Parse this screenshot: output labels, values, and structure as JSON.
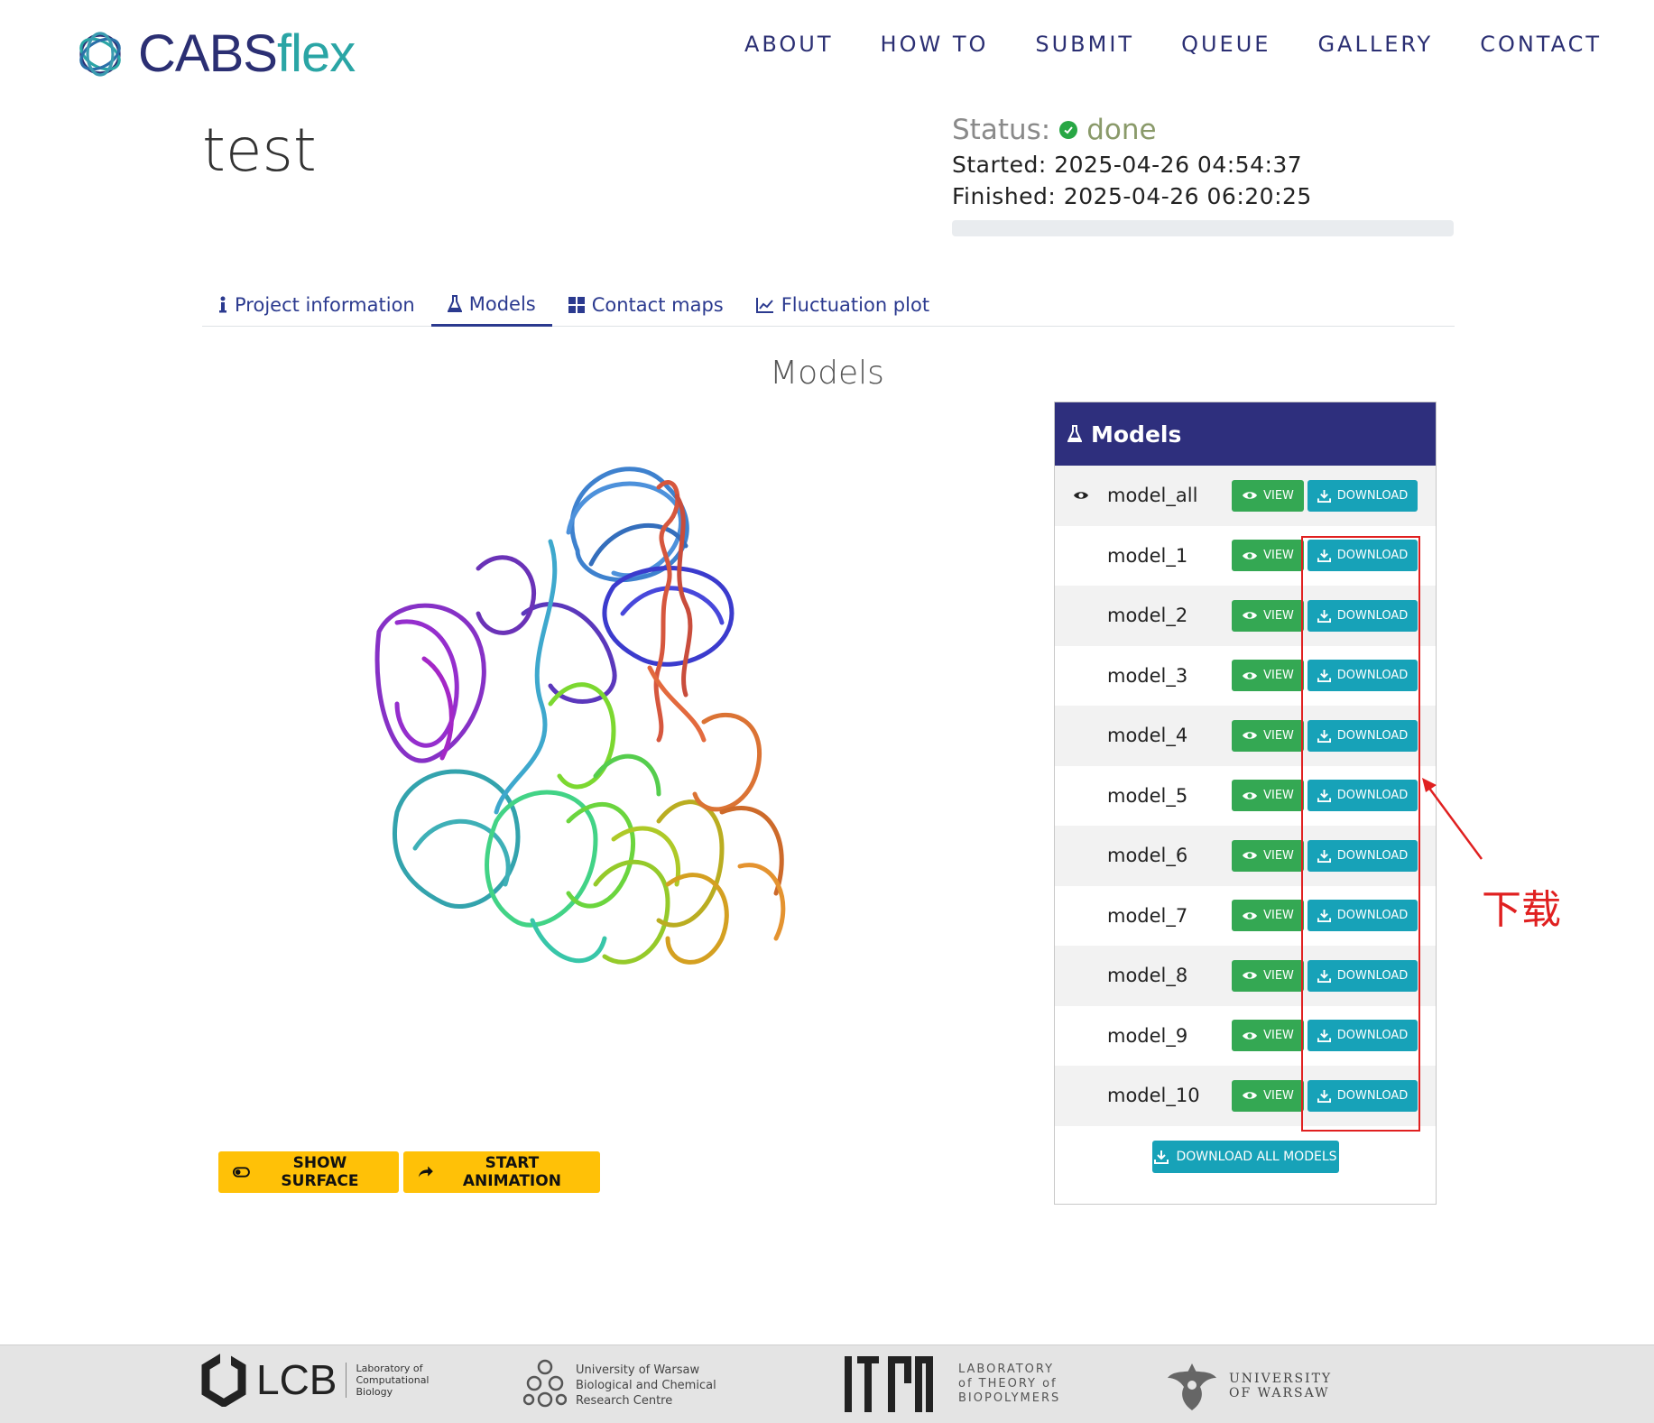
{
  "brand": {
    "part1": "CABS",
    "part2": "flex"
  },
  "nav": [
    "ABOUT",
    "HOW TO",
    "SUBMIT",
    "QUEUE",
    "GALLERY",
    "CONTACT"
  ],
  "project": {
    "title": "test",
    "status_label": "Status:",
    "status_value": "done",
    "started": "Started: 2025-04-26 04:54:37",
    "finished": "Finished: 2025-04-26 06:20:25",
    "progress": 1.0
  },
  "tabs": [
    {
      "label": "Project information",
      "icon": "info-icon",
      "active": false
    },
    {
      "label": "Models",
      "icon": "flask-icon",
      "active": true
    },
    {
      "label": "Contact maps",
      "icon": "grid-icon",
      "active": false
    },
    {
      "label": "Fluctuation plot",
      "icon": "chart-icon",
      "active": false
    }
  ],
  "section_title": "Models",
  "viewer_buttons": {
    "surface": "SHOW SURFACE",
    "animation": "START ANIMATION"
  },
  "models_panel": {
    "title": "Models",
    "view_label": "VIEW",
    "download_label": "DOWNLOAD",
    "download_all_label": "DOWNLOAD ALL MODELS",
    "models": [
      "model_all",
      "model_1",
      "model_2",
      "model_3",
      "model_4",
      "model_5",
      "model_6",
      "model_7",
      "model_8",
      "model_9",
      "model_10"
    ],
    "active_model": "model_all"
  },
  "annotation": {
    "text": "下载",
    "color": "#e02020"
  },
  "footer": {
    "lcb": {
      "abbr": "LCB",
      "line1": "Laboratory of",
      "line2": "Computational",
      "line3": "Biology"
    },
    "uw_center": {
      "line1": "University of Warsaw",
      "line2": "Biological and Chemical",
      "line3": "Research Centre"
    },
    "ltb": {
      "line1": "LABORATORY",
      "line2": "of THEORY of",
      "line3": "BIOPOLYMERS"
    },
    "uw": {
      "line1": "UNIVERSITY",
      "line2": "OF WARSAW"
    }
  },
  "colors": {
    "brand_dark": "#2b2f73",
    "brand_teal": "#2aa5a5",
    "panel_head": "#2e2f7d",
    "view_green": "#34a853",
    "download_teal": "#17a2b8",
    "yellow": "#ffc107"
  }
}
